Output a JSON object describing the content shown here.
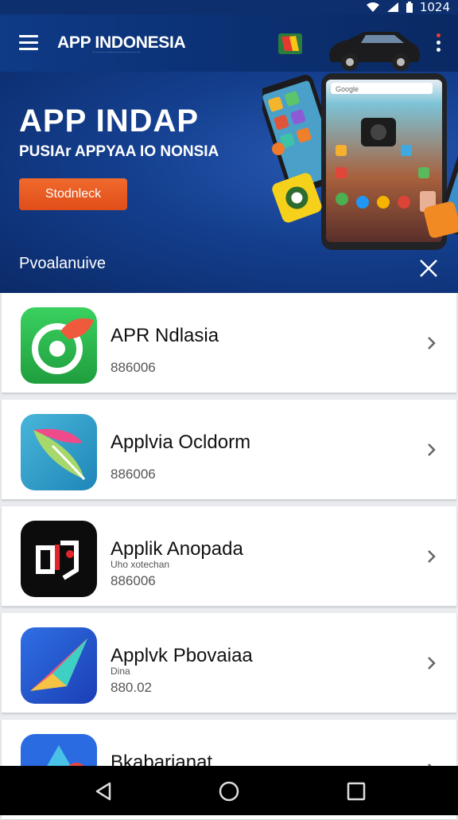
{
  "status_bar": {
    "time": "1024"
  },
  "app_bar": {
    "title": "APP INDONESIA",
    "subtitle": "............................"
  },
  "banner": {
    "title": "APP INDAP",
    "subtitle": "PUSIAr APPYAA IO NONSIA",
    "button_label": "Stodnleck",
    "caption": "Pvoalanuive",
    "screen_url": "Google"
  },
  "apps": [
    {
      "name": "APR Ndlasia",
      "sub": "",
      "meta": "886006"
    },
    {
      "name": "Applvia Ocldorm",
      "sub": "",
      "meta": "886006"
    },
    {
      "name": "Applik Anopada",
      "sub": "Uho xotechan",
      "meta": "886006"
    },
    {
      "name": "Applvk Pbovaiaa",
      "sub": "Dina",
      "meta": "880.02"
    },
    {
      "name": "Bkabarianat",
      "sub": "",
      "meta": ""
    }
  ],
  "colors": {
    "app_bar": "#0e3a86",
    "banner_button": "#e85a22",
    "nav_bar": "#000000"
  }
}
